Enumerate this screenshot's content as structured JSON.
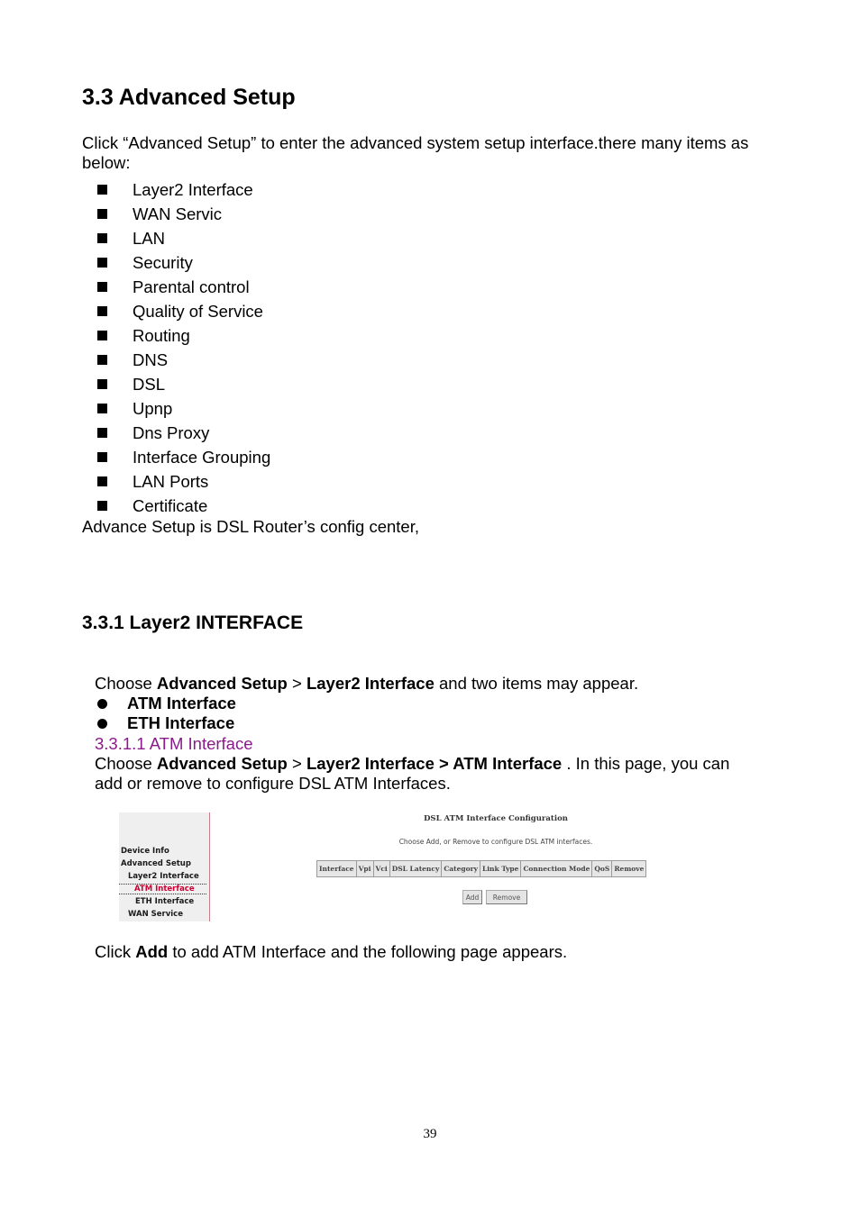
{
  "section": {
    "title": "3.3 Advanced Setup",
    "intro": "Click “Advanced Setup” to enter the advanced system setup interface.there many items as below:",
    "items": [
      "Layer2 Interface",
      "WAN Servic",
      "LAN",
      "Security",
      "Parental control",
      "Quality of Service",
      "Routing",
      "DNS",
      "DSL",
      "Upnp",
      "Dns Proxy",
      "Interface Grouping",
      "LAN Ports",
      "Certificate"
    ],
    "note": "Advance Setup is DSL Router’s config center,"
  },
  "subsection": {
    "title": "3.3.1 Layer2 INTERFACE",
    "choose1": {
      "pre": "Choose ",
      "b1": "Advanced Setup",
      "sep": " > ",
      "b2": "Layer2 Interface",
      "post": " and two items may appear."
    },
    "items": [
      "ATM Interface",
      "ETH Interface"
    ],
    "subsub_title": "3.3.1.1 ATM Interface",
    "choose2": {
      "pre": "Choose ",
      "b1": "Advanced Setup",
      "sep": " > ",
      "b2": "Layer2 Interface > ATM Interface",
      "post": " . In this page, you can",
      "line2": "add or remove to configure DSL ATM Interfaces."
    },
    "click_add": {
      "pre": "Click ",
      "b": "Add",
      "post": " to add ATM Interface and the following page appears."
    }
  },
  "screenshot": {
    "sidebar": [
      "Device Info",
      "Advanced Setup",
      "Layer2 Interface",
      "ATM Interface",
      "ETH Interface",
      "WAN Service"
    ],
    "active_item": "ATM Interface",
    "title": "DSL ATM Interface Configuration",
    "description": "Choose Add, or Remove to configure DSL ATM interfaces.",
    "columns": [
      "Interface",
      "Vpi",
      "Vci",
      "DSL Latency",
      "Category",
      "Link Type",
      "Connection Mode",
      "QoS",
      "Remove"
    ],
    "buttons": {
      "add": "Add",
      "remove": "Remove"
    },
    "colors": {
      "active": "#cc0033",
      "header_bg": "#e6e6e6",
      "subheading": "#8b1a8b"
    }
  },
  "page_number": "39"
}
